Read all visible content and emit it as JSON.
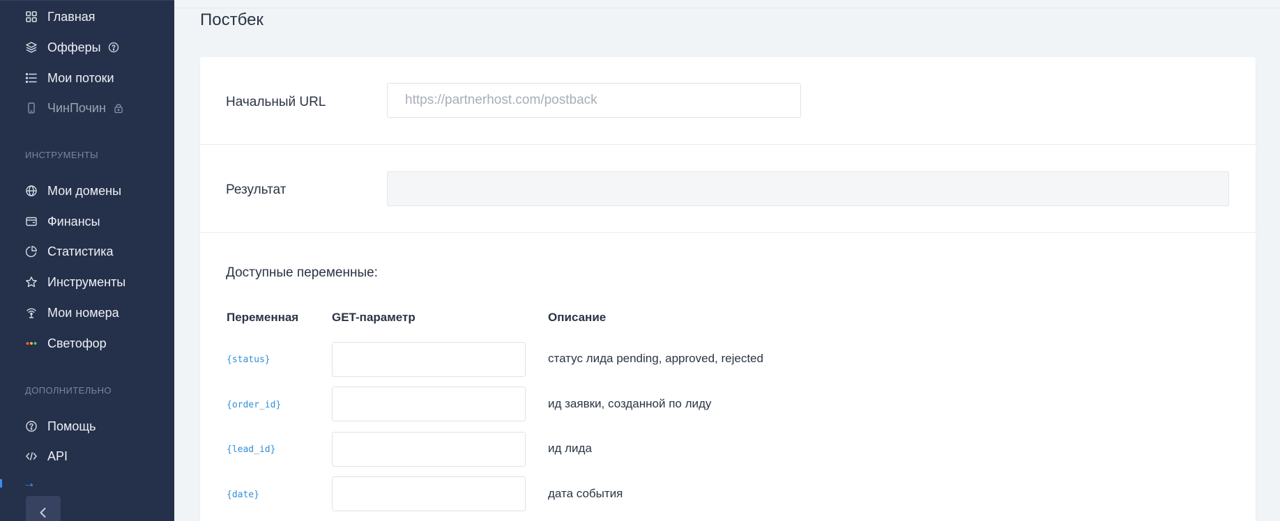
{
  "sidebar": {
    "items_main": [
      {
        "label": "Главная",
        "icon": "grid-icon"
      },
      {
        "label": "Офферы",
        "icon": "layers-icon",
        "suffix": "help-circle-icon"
      },
      {
        "label": "Мои потоки",
        "icon": "list-icon"
      },
      {
        "label": "ЧинПочин",
        "icon": "phone-icon",
        "suffix": "lock-icon",
        "disabled": true
      }
    ],
    "section_tools": "ИНСТРУМЕНТЫ",
    "items_tools": [
      {
        "label": "Мои домены",
        "icon": "globe-icon"
      },
      {
        "label": "Финансы",
        "icon": "wallet-icon"
      },
      {
        "label": "Статистика",
        "icon": "pie-chart-icon"
      },
      {
        "label": "Инструменты",
        "icon": "star-icon"
      },
      {
        "label": "Мои номера",
        "icon": "antenna-icon"
      },
      {
        "label": "Светофор",
        "icon": "traffic-light-icon"
      }
    ],
    "section_extra": "ДОПОЛНИТЕЛЬНО",
    "items_extra": [
      {
        "label": "Помощь",
        "icon": "help-circle-icon"
      },
      {
        "label": "API",
        "icon": "code-icon"
      }
    ],
    "colors": {
      "background": "#25304a",
      "accent": "#3b8ef0"
    }
  },
  "page": {
    "title": "Постбек"
  },
  "form": {
    "url_label": "Начальный URL",
    "url_placeholder": "https://partnerhost.com/postback",
    "url_value": "",
    "result_label": "Результат",
    "result_value": ""
  },
  "variables": {
    "heading": "Доступные переменные:",
    "columns": [
      "Переменная",
      "GET-параметр",
      "Описание"
    ],
    "rows": [
      {
        "variable": "{status}",
        "param": "",
        "description": "статус лида pending, approved, rejected"
      },
      {
        "variable": "{order_id}",
        "param": "",
        "description": "ид заявки, созданной по лиду"
      },
      {
        "variable": "{lead_id}",
        "param": "",
        "description": "ид лида"
      },
      {
        "variable": "{date}",
        "param": "",
        "description": "дата события"
      }
    ],
    "variable_color": "#2f8fd8"
  }
}
